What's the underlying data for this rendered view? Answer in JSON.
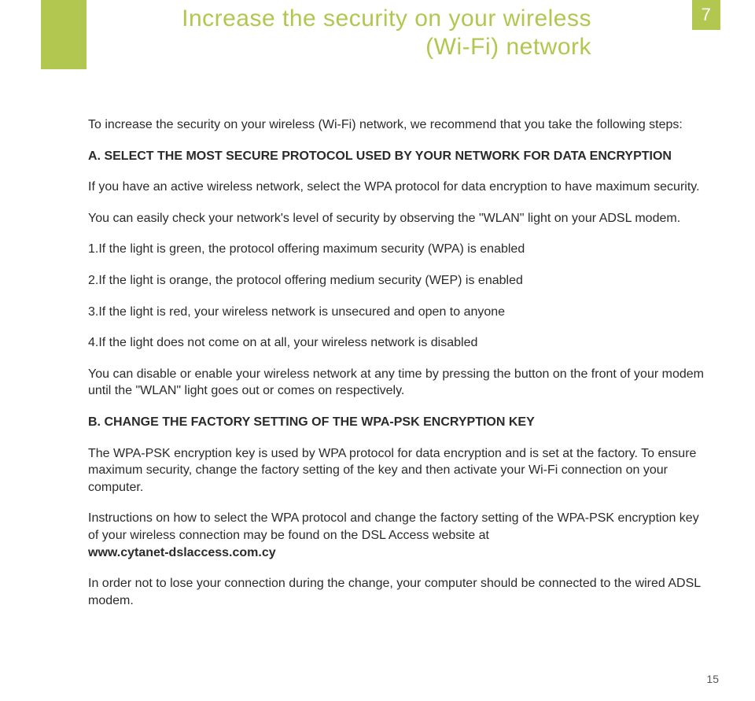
{
  "colors": {
    "accent": "#b1c74f"
  },
  "page": {
    "chapter": "7",
    "number": "15"
  },
  "title": {
    "line1": "Increase the security on your wireless",
    "line2": "(Wi-Fi) network"
  },
  "intro": "To increase the security on your wireless (Wi-Fi) network, we recommend that you take the following steps:",
  "sectionA": {
    "heading_prefix": "A.",
    "heading": "SELECT THE MOST SECURE PROTOCOL USED BY YOUR NETWORK FOR DATA ENCRYPTION",
    "p1": "If you have an active wireless network, select the WPA protocol for data encryption to have maximum security.",
    "p2": "You can easily check your network's level of security by observing the \"WLAN\" light on your ADSL modem.",
    "list": {
      "i1": "1.If the light is green, the protocol offering maximum security (WPA) is enabled",
      "i2": "2.If the light is orange, the protocol offering medium security (WEP) is enabled",
      "i3": "3.If the light is red, your wireless network is unsecured and open to anyone",
      "i4": "4.If the light does not come on at all, your wireless network is disabled"
    },
    "p3": "You can disable or enable your wireless network at any time by pressing the button on the front of your modem until the \"WLAN\" light goes out or comes on respectively."
  },
  "sectionB": {
    "heading_prefix": "B.",
    "heading": "CHANGE THE FACTORY SETTING OF THE WPA-PSK ENCRYPTION KEY",
    "p1": "The WPA-PSK encryption key is used by WPA protocol for data encryption and is set at the factory. To ensure maximum security, change the factory setting of the key and then activate your Wi-Fi connection on your computer.",
    "p2a": "Instructions on how to select the WPA protocol and change the factory setting of the WPA-PSK encryption key of your wireless connection may be found on the DSL Access website at",
    "url": "www.cytanet-dslaccess.com.cy",
    "p3": "In order not to lose your connection during the change, your computer should be connected to the wired ADSL modem."
  }
}
